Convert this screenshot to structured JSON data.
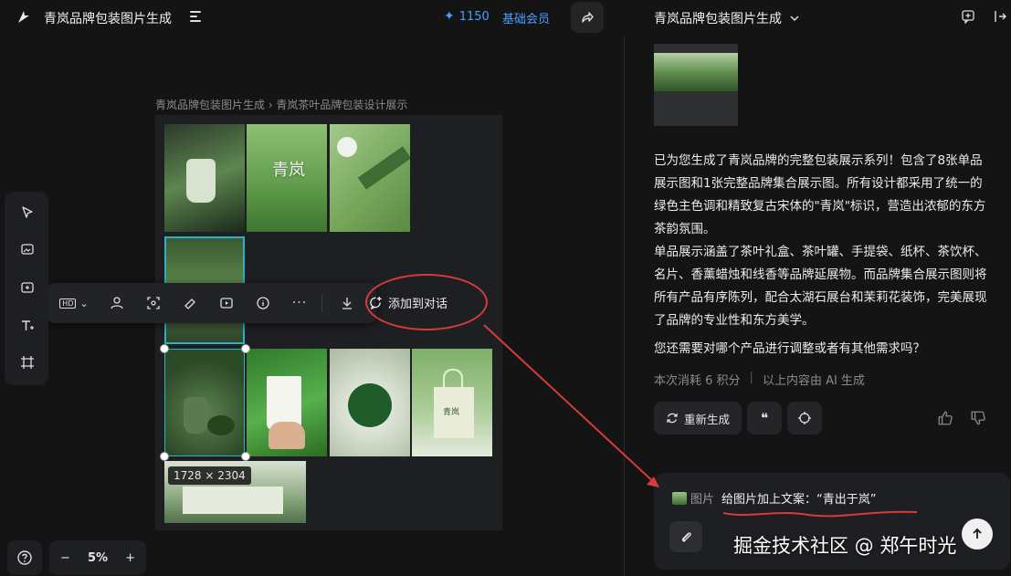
{
  "topbar": {
    "title": "青岚品牌包装图片生成",
    "credits": "1150",
    "member": "基础会员"
  },
  "breadcrumb": "青岚品牌包装图片生成 › 青岚茶叶品牌包装设计展示",
  "gallery": {
    "brand_text": "青岚",
    "bag_text": "青岚",
    "selected_dimensions": "1728 × 2304"
  },
  "float_toolbar": {
    "quality": "HD",
    "add_to_chat": "添加到对话"
  },
  "zoom": {
    "level": "5%",
    "minus": "−",
    "plus": "+"
  },
  "right_panel": {
    "title": "青岚品牌包装图片生成",
    "message_p1": "已为您生成了青岚品牌的完整包装展示系列！包含了8张单品展示图和1张完整品牌集合展示图。所有设计都采用了统一的绿色主色调和精致复古宋体的\"青岚\"标识，营造出浓郁的东方茶韵氛围。",
    "message_p2": "单品展示涵盖了茶叶礼盒、茶叶罐、手提袋、纸杯、茶饮杯、名片、香薰蜡烛和线香等品牌延展物。而品牌集合展示图则将所有产品有序陈列，配合太湖石展台和茉莉花装饰，完美展现了品牌的专业性和东方美学。",
    "message_p3": "您还需要对哪个产品进行调整或者有其他需求吗？",
    "cost": "本次消耗 6 积分",
    "meta_sep": "|",
    "ai_note": "以上内容由 AI 生成",
    "regenerate": "重新生成",
    "quote_icon": "❝"
  },
  "input": {
    "quote_label": "图片",
    "quote_text": "给图片加上文案：“青出于岚”"
  },
  "watermark": "掘金技术社区 @ 郑午时光",
  "colors": {
    "accent_blue": "#4a9eff",
    "annotation_red": "#d93a3a",
    "selection_cyan": "#2ab3c4"
  }
}
